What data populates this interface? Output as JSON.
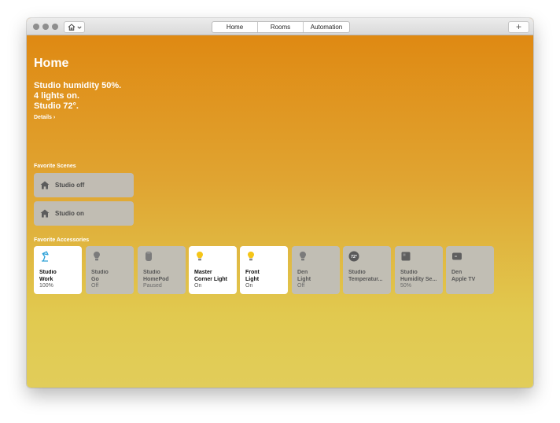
{
  "tabs": [
    {
      "label": "Home",
      "active": true
    },
    {
      "label": "Rooms",
      "active": false
    },
    {
      "label": "Automation",
      "active": false
    }
  ],
  "toolbar": {
    "add_label": "+"
  },
  "home": {
    "title": "Home",
    "status_lines": [
      "Studio humidity 50%.",
      "4 lights on.",
      "Studio 72°."
    ],
    "details_label": "Details ›"
  },
  "scenes": {
    "label": "Favorite Scenes",
    "items": [
      {
        "label": "Studio off",
        "icon": "house-icon"
      },
      {
        "label": "Studio on",
        "icon": "house-icon"
      }
    ]
  },
  "accessories": {
    "label": "Favorite Accessories",
    "items": [
      {
        "line1": "Studio",
        "line2": "Work",
        "status": "100%",
        "icon": "desk-lamp-icon",
        "on": true
      },
      {
        "line1": "Studio",
        "line2": "Go",
        "status": "Off",
        "icon": "bulb-icon",
        "on": false
      },
      {
        "line1": "Studio",
        "line2": "HomePod",
        "status": "Paused",
        "icon": "homepod-icon",
        "on": false
      },
      {
        "line1": "Master",
        "line2": "Corner Light",
        "status": "On",
        "icon": "bulb-icon",
        "on": true
      },
      {
        "line1": "Front",
        "line2": "Light",
        "status": "On",
        "icon": "bulb-icon",
        "on": true
      },
      {
        "line1": "Den",
        "line2": "Light",
        "status": "Off",
        "icon": "bulb-icon",
        "on": false
      },
      {
        "line1": "Studio",
        "line2": "Temperatur...",
        "status": "",
        "icon": "thermostat-icon",
        "icon_text": "72°",
        "on": false
      },
      {
        "line1": "Studio",
        "line2": "Humidity Se...",
        "status": "50%",
        "icon": "humidity-sensor-icon",
        "on": false
      },
      {
        "line1": "Den",
        "line2": "Apple TV",
        "status": "",
        "icon": "apple-tv-icon",
        "on": false
      }
    ]
  },
  "colors": {
    "gradient_top": "#df860f",
    "gradient_bottom": "#e1cd5a",
    "bulb_on": "#f5c518",
    "lamp_on": "#2fa2d8",
    "icon_off": "#7b7b7b"
  }
}
